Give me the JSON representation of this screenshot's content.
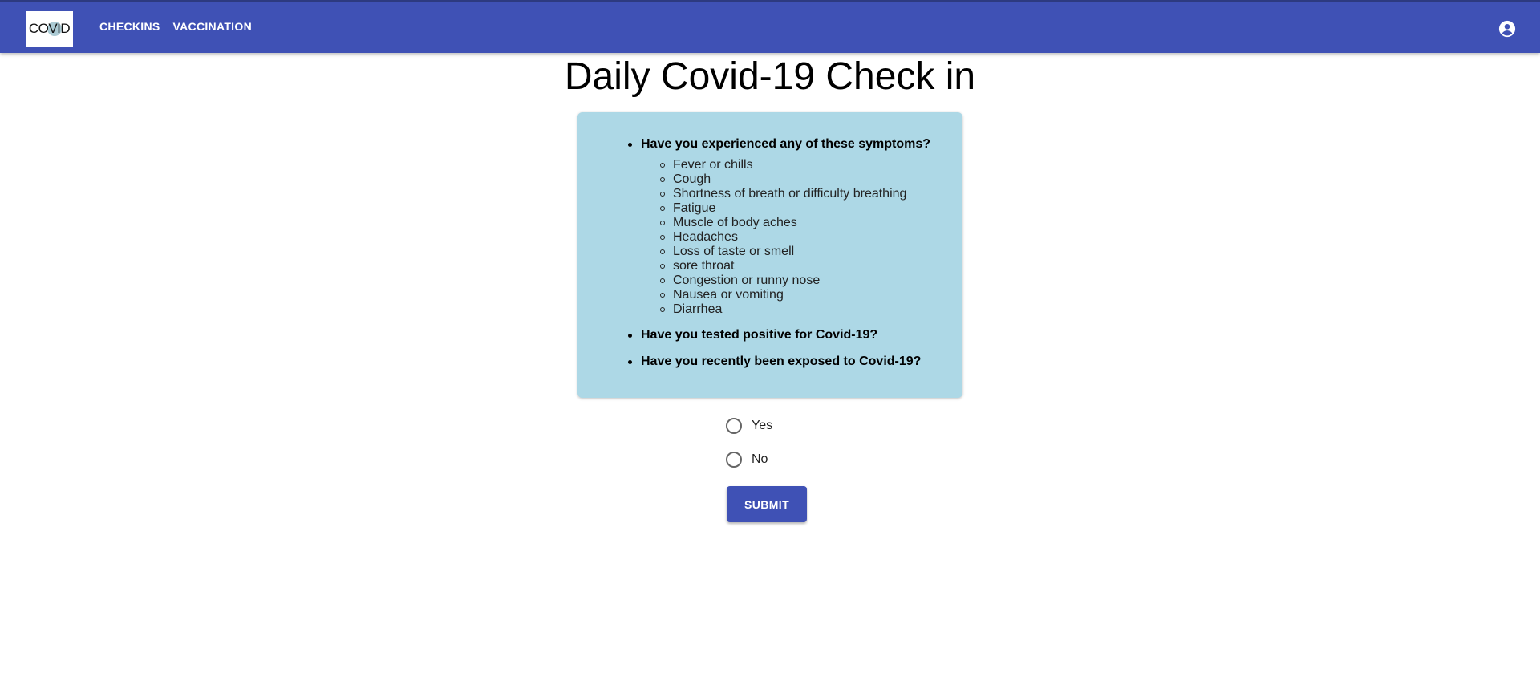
{
  "appbar": {
    "logo_text": "COVID",
    "nav": [
      {
        "label": "CHECKINS"
      },
      {
        "label": "VACCINATION"
      }
    ],
    "account_icon": "account-circle-icon",
    "color": "#3f51b5"
  },
  "page": {
    "title": "Daily Covid-19 Check in"
  },
  "questions_card": {
    "background": "#add8e6",
    "questions": [
      {
        "text": "Have you experienced any of these symptoms?"
      },
      {
        "text": "Have you tested positive for Covid-19?"
      },
      {
        "text": "Have you recently been exposed to Covid-19?"
      }
    ],
    "symptoms": [
      "Fever or chills",
      "Cough",
      "Shortness of breath or difficulty breathing",
      "Fatigue",
      "Muscle of body aches",
      "Headaches",
      "Loss of taste or smell",
      "sore throat",
      "Congestion or runny nose",
      "Nausea or vomiting",
      "Diarrhea"
    ]
  },
  "form": {
    "options": [
      {
        "label": "Yes",
        "selected": false
      },
      {
        "label": "No",
        "selected": false
      }
    ],
    "submit_label": "SUBMIT"
  }
}
